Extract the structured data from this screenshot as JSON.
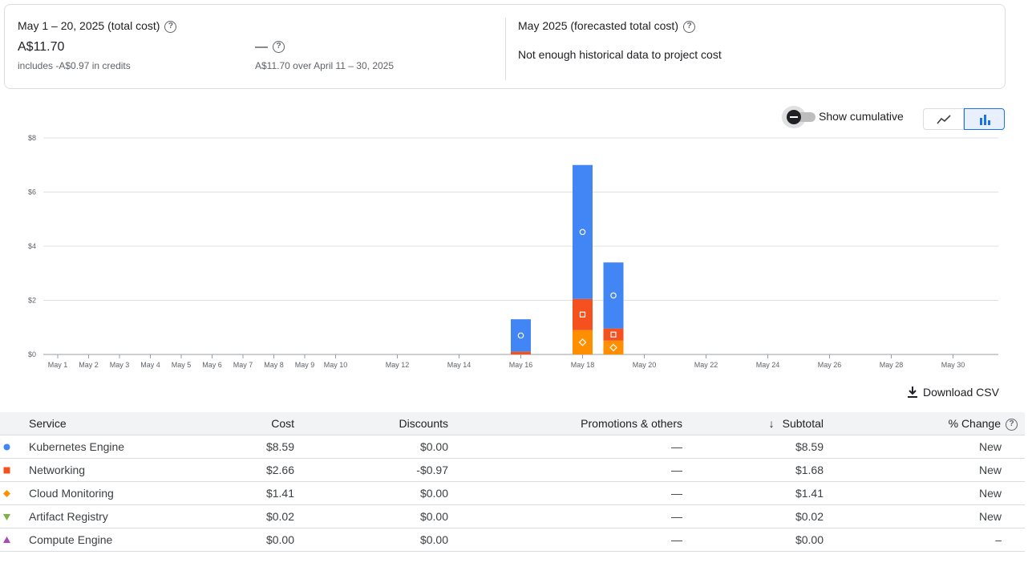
{
  "summary": {
    "period_label": "May 1 – 20, 2025 (total cost)",
    "total_cost": "A$11.70",
    "credits_note": "includes -A$0.97 in credits",
    "comparison_value": "—",
    "comparison_note": "A$11.70 over April 11 – 30, 2025",
    "forecast_label": "May 2025 (forecasted total cost)",
    "forecast_note": "Not enough historical data to project cost"
  },
  "controls": {
    "cumulative_label": "Show cumulative",
    "cumulative_on": false,
    "chart_type_selected": "bar"
  },
  "chart_data": {
    "type": "bar",
    "stacked": true,
    "y_ticks": [
      "$8",
      "$6",
      "$4",
      "$2",
      "$0"
    ],
    "ylim": [
      0,
      8
    ],
    "x_tick_labels": [
      "May 1",
      "May 2",
      "May 3",
      "May 4",
      "May 5",
      "May 6",
      "May 7",
      "May 8",
      "May 9",
      "May 10",
      "May 12",
      "May 14",
      "May 16",
      "May 18",
      "May 20",
      "May 22",
      "May 24",
      "May 26",
      "May 28",
      "May 30"
    ],
    "categories": [
      "May 16",
      "May 18",
      "May 19"
    ],
    "series": [
      {
        "name": "Cloud Monitoring",
        "color": "#ff8f00",
        "marker": "diamond",
        "values": [
          0.0,
          0.9,
          0.51
        ]
      },
      {
        "name": "Networking",
        "color": "#f4511e",
        "marker": "square",
        "values": [
          0.1,
          1.15,
          0.45
        ]
      },
      {
        "name": "Kubernetes Engine",
        "color": "#4285f4",
        "marker": "circle",
        "values": [
          1.2,
          4.95,
          2.44
        ]
      }
    ],
    "grid": true
  },
  "download_label": "Download CSV",
  "table": {
    "headers": {
      "service": "Service",
      "cost": "Cost",
      "discounts": "Discounts",
      "promotions": "Promotions & others",
      "subtotal": "Subtotal",
      "change": "% Change"
    },
    "rows": [
      {
        "service": "Kubernetes Engine",
        "cost": "$8.59",
        "discounts": "$0.00",
        "promotions": "—",
        "subtotal": "$8.59",
        "change": "New",
        "color": "#4285f4",
        "marker": "circle"
      },
      {
        "service": "Networking",
        "cost": "$2.66",
        "discounts": "-$0.97",
        "promotions": "—",
        "subtotal": "$1.68",
        "change": "New",
        "color": "#f4511e",
        "marker": "square"
      },
      {
        "service": "Cloud Monitoring",
        "cost": "$1.41",
        "discounts": "$0.00",
        "promotions": "—",
        "subtotal": "$1.41",
        "change": "New",
        "color": "#ff8f00",
        "marker": "diamond"
      },
      {
        "service": "Artifact Registry",
        "cost": "$0.02",
        "discounts": "$0.00",
        "promotions": "—",
        "subtotal": "$0.02",
        "change": "New",
        "color": "#7cb342",
        "marker": "triangle-down"
      },
      {
        "service": "Compute Engine",
        "cost": "$0.00",
        "discounts": "$0.00",
        "promotions": "—",
        "subtotal": "$0.00",
        "change": "–",
        "color": "#ab47bc",
        "marker": "triangle-up"
      }
    ]
  }
}
